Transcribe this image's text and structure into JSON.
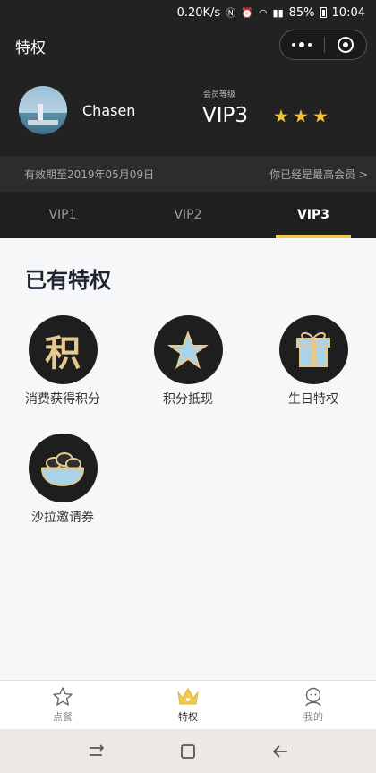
{
  "status_bar": {
    "speed": "0.20K/s",
    "battery": "85%",
    "time": "10:04"
  },
  "header": {
    "title": "特权"
  },
  "profile": {
    "username": "Chasen",
    "level_label": "会员等级",
    "level_value": "VIP3",
    "star_count": 3,
    "star_color": "#f5c431"
  },
  "validity": {
    "text": "有效期至2019年05月09日",
    "top_link": "你已经是最高会员 >"
  },
  "tabs": [
    {
      "label": "VIP1",
      "active": false
    },
    {
      "label": "VIP2",
      "active": false
    },
    {
      "label": "VIP3",
      "active": true
    }
  ],
  "section": {
    "title": "已有特权"
  },
  "privileges": [
    {
      "label": "消费获得积分",
      "icon": "ji-points-icon",
      "glyph": "积"
    },
    {
      "label": "积分抵现",
      "icon": "star-icon"
    },
    {
      "label": "生日特权",
      "icon": "gift-icon"
    },
    {
      "label": "沙拉邀请券",
      "icon": "salad-bowl-icon"
    }
  ],
  "tabbar": [
    {
      "label": "点餐",
      "icon": "star-outline-icon"
    },
    {
      "label": "特权",
      "icon": "crown-icon",
      "active": true
    },
    {
      "label": "我的",
      "icon": "user-face-icon"
    }
  ],
  "colors": {
    "accent": "#f2c94c",
    "dark": "#222222"
  }
}
